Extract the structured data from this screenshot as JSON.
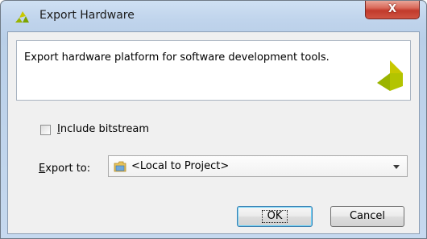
{
  "window": {
    "title": "Export Hardware",
    "close_label": "X"
  },
  "header": {
    "description": "Export hardware platform for software development tools."
  },
  "options": {
    "include_bitstream": {
      "label_accel": "I",
      "label_rest": "nclude bitstream",
      "checked": false
    },
    "export_to": {
      "label_accel": "E",
      "label_rest": "xport to:",
      "selected_value": "<Local to Project>"
    }
  },
  "buttons": {
    "ok": "OK",
    "cancel": "Cancel"
  },
  "colors": {
    "logo_yellow": "#c8c800",
    "logo_green": "#9ab400",
    "close_red": "#c13a2b",
    "panel_bg": "#f0f0f0"
  },
  "icons": {
    "title": "xilinx-logo-icon",
    "header": "xilinx-logo-icon",
    "combo": "folder-icon",
    "dropdown": "chevron-down-icon"
  }
}
